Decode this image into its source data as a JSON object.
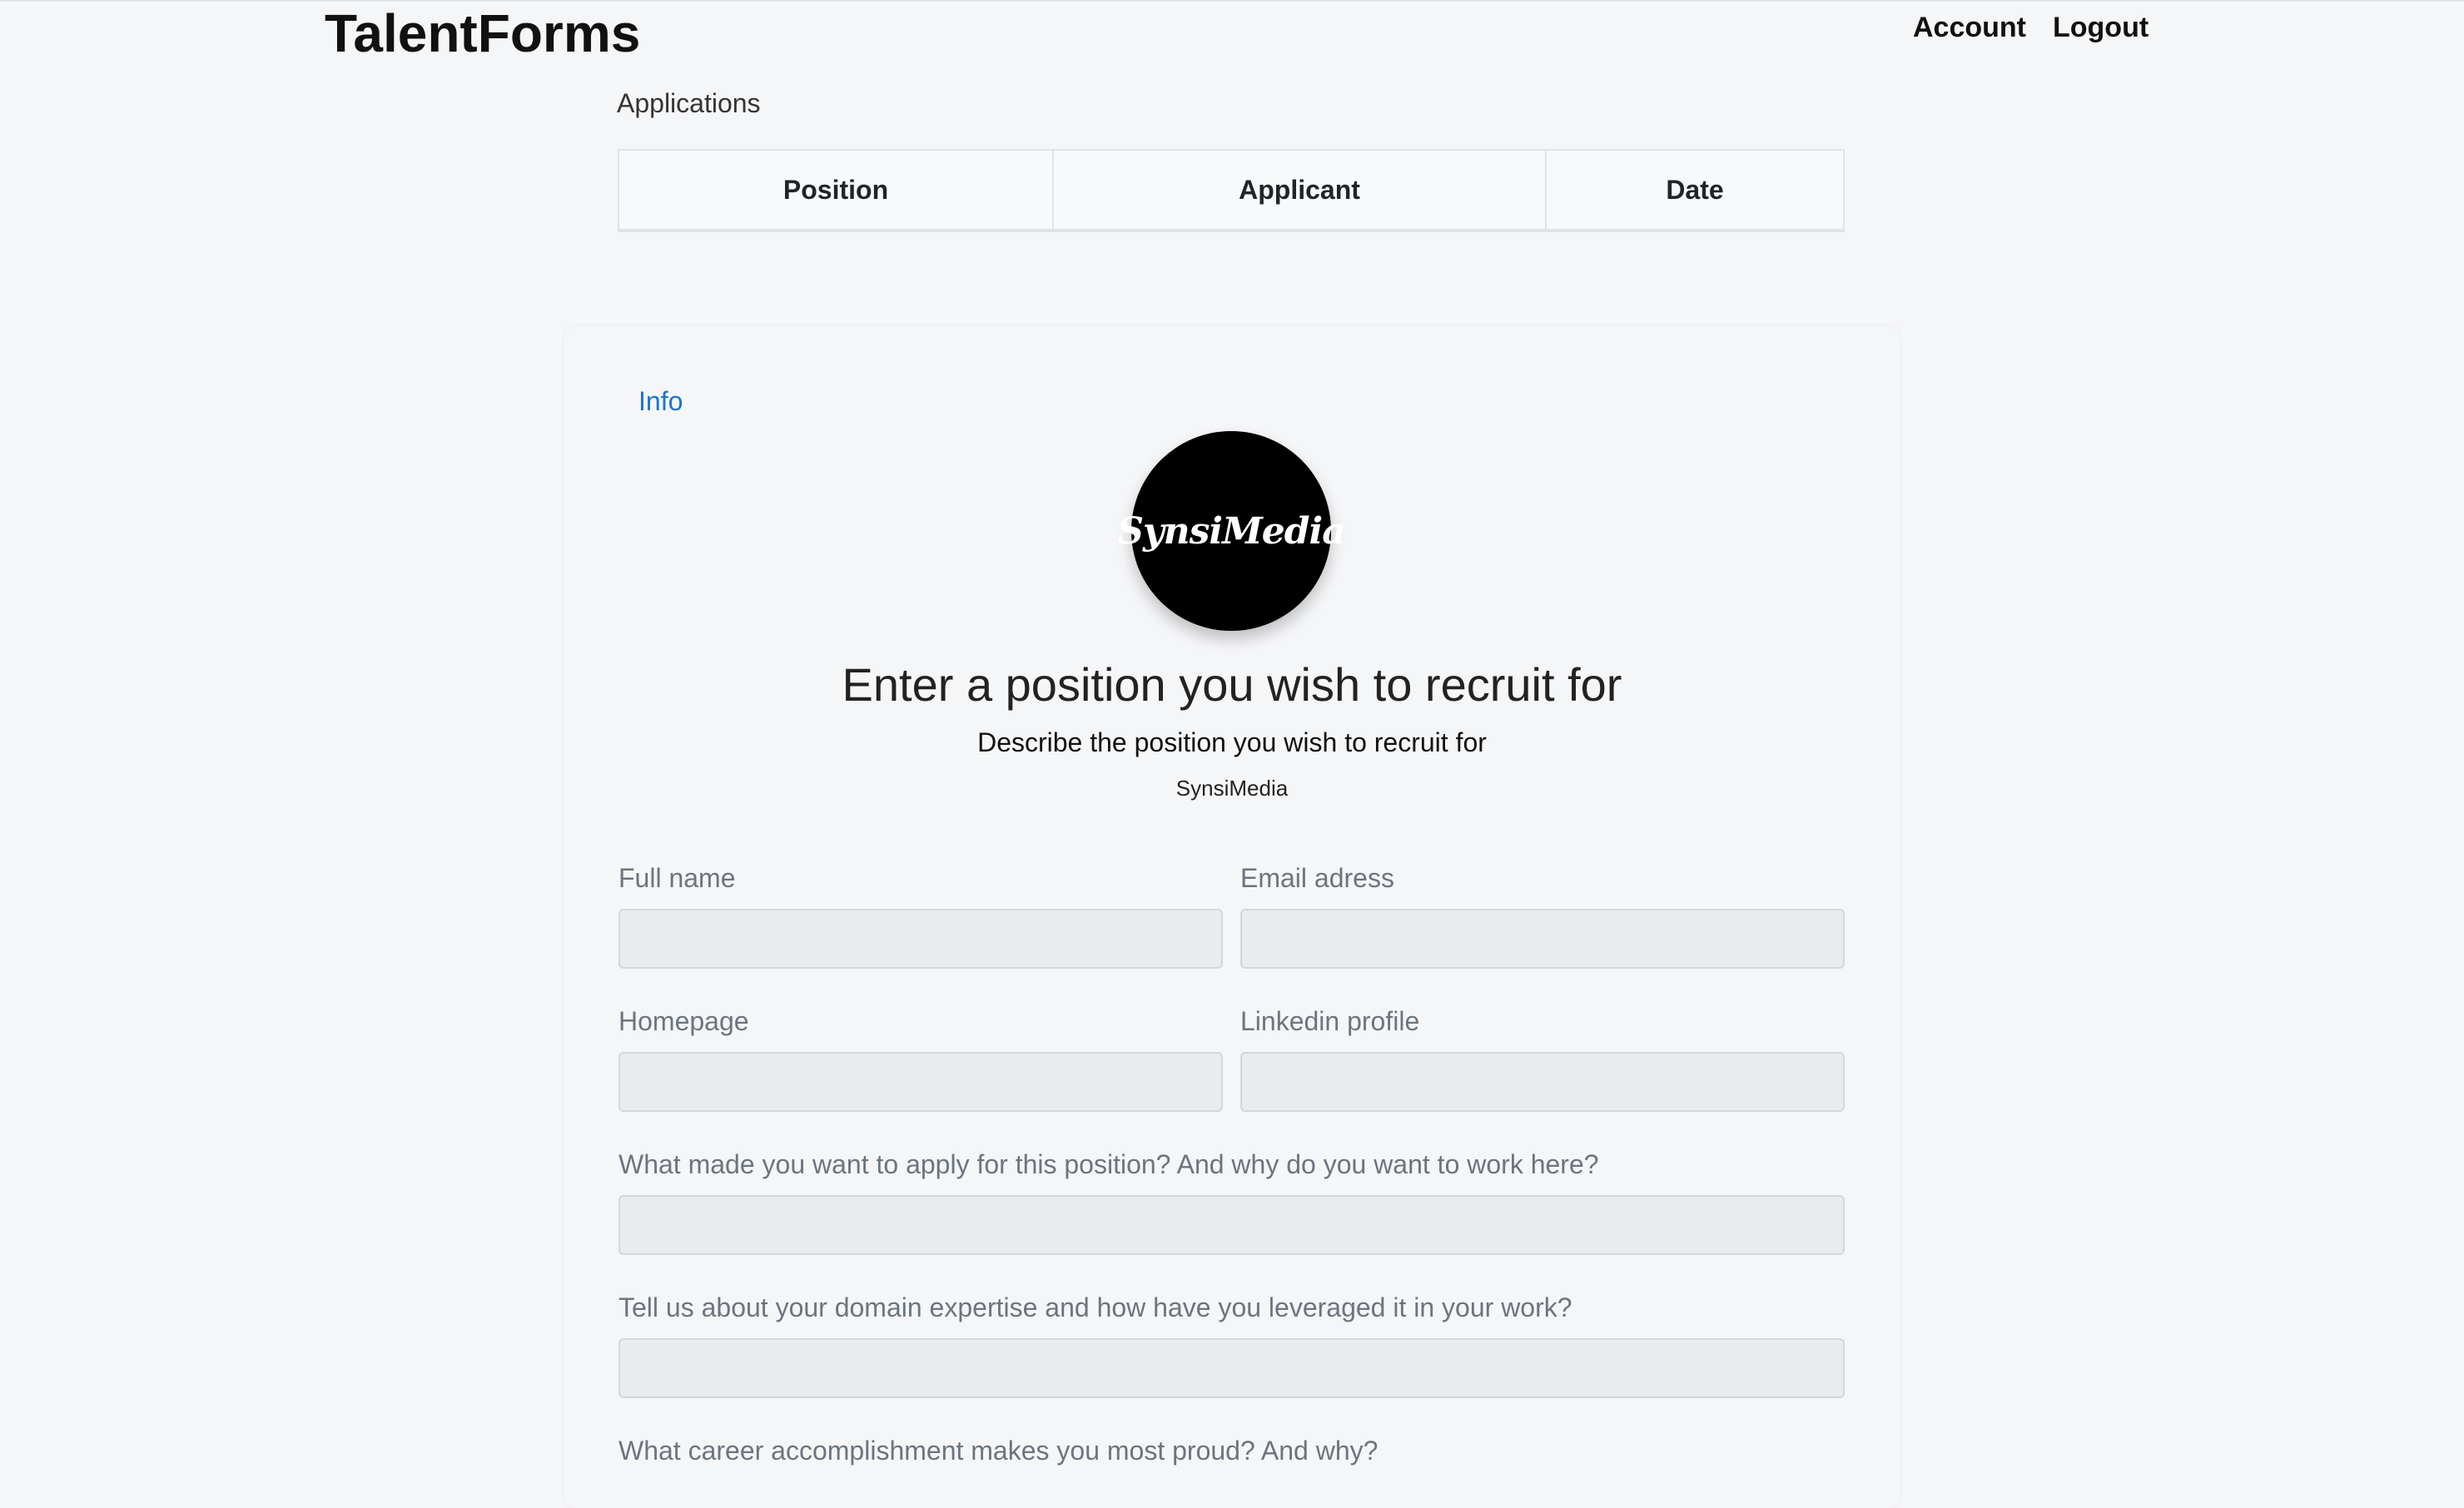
{
  "header": {
    "brand": "TalentForms",
    "nav": {
      "account": "Account",
      "logout": "Logout"
    }
  },
  "applications": {
    "title": "Applications",
    "columns": [
      "Position",
      "Applicant",
      "Date"
    ]
  },
  "card": {
    "info_link": "Info",
    "logo_text": "SynsiMedia",
    "title": "Enter a position you wish to recruit for",
    "description": "Describe the position you wish to recruit for",
    "company": "SynsiMedia"
  },
  "form": {
    "full_name": {
      "label": "Full name",
      "value": ""
    },
    "email": {
      "label": "Email adress",
      "value": ""
    },
    "homepage": {
      "label": "Homepage",
      "value": ""
    },
    "linkedin": {
      "label": "Linkedin profile",
      "value": ""
    },
    "q1": {
      "label": "What made you want to apply for this position? And why do you want to work here?",
      "value": ""
    },
    "q2": {
      "label": "Tell us about your domain expertise and how have you leveraged it in your work?",
      "value": ""
    },
    "q3": {
      "label": "What career accomplishment makes you most proud? And why?"
    }
  }
}
